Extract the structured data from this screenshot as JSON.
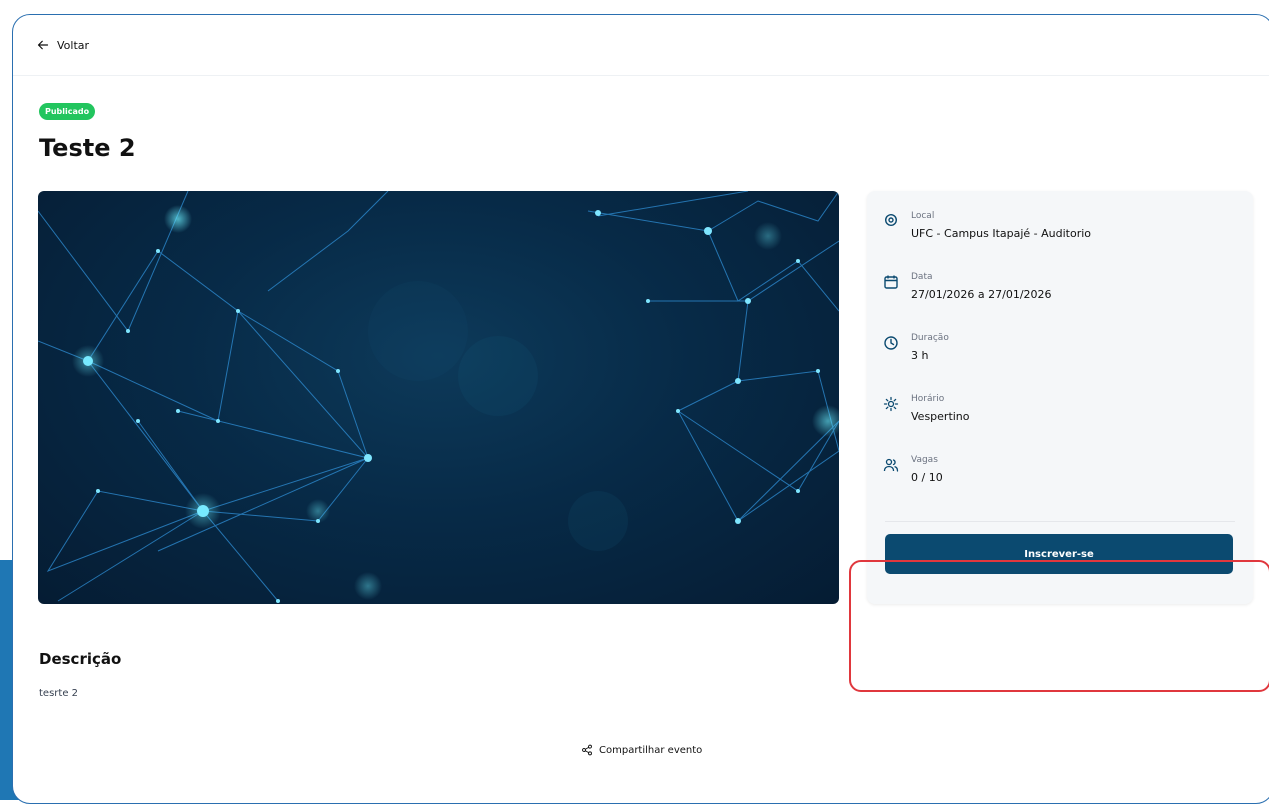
{
  "topbar": {
    "back_label": "Voltar"
  },
  "event": {
    "status_badge": "Publicado",
    "title": "Teste 2",
    "description_heading": "Descrição",
    "description_text": "tesrte 2"
  },
  "info": {
    "local": {
      "label": "Local",
      "value": "UFC - Campus Itapajé - Auditorio",
      "icon": "map-pin-icon"
    },
    "data": {
      "label": "Data",
      "value": "27/01/2026 a 27/01/2026",
      "icon": "calendar-icon"
    },
    "duracao": {
      "label": "Duração",
      "value": "3 h",
      "icon": "clock-icon"
    },
    "horario": {
      "label": "Horário",
      "value": "Vespertino",
      "icon": "sun-icon"
    },
    "vagas": {
      "label": "Vagas",
      "value": "0 / 10",
      "icon": "users-icon"
    }
  },
  "actions": {
    "subscribe_label": "Inscrever-se",
    "share_label": "Compartilhar evento"
  },
  "colors": {
    "badge": "#22c55e",
    "primary_button": "#0b4a70",
    "highlight": "#e0373d"
  }
}
